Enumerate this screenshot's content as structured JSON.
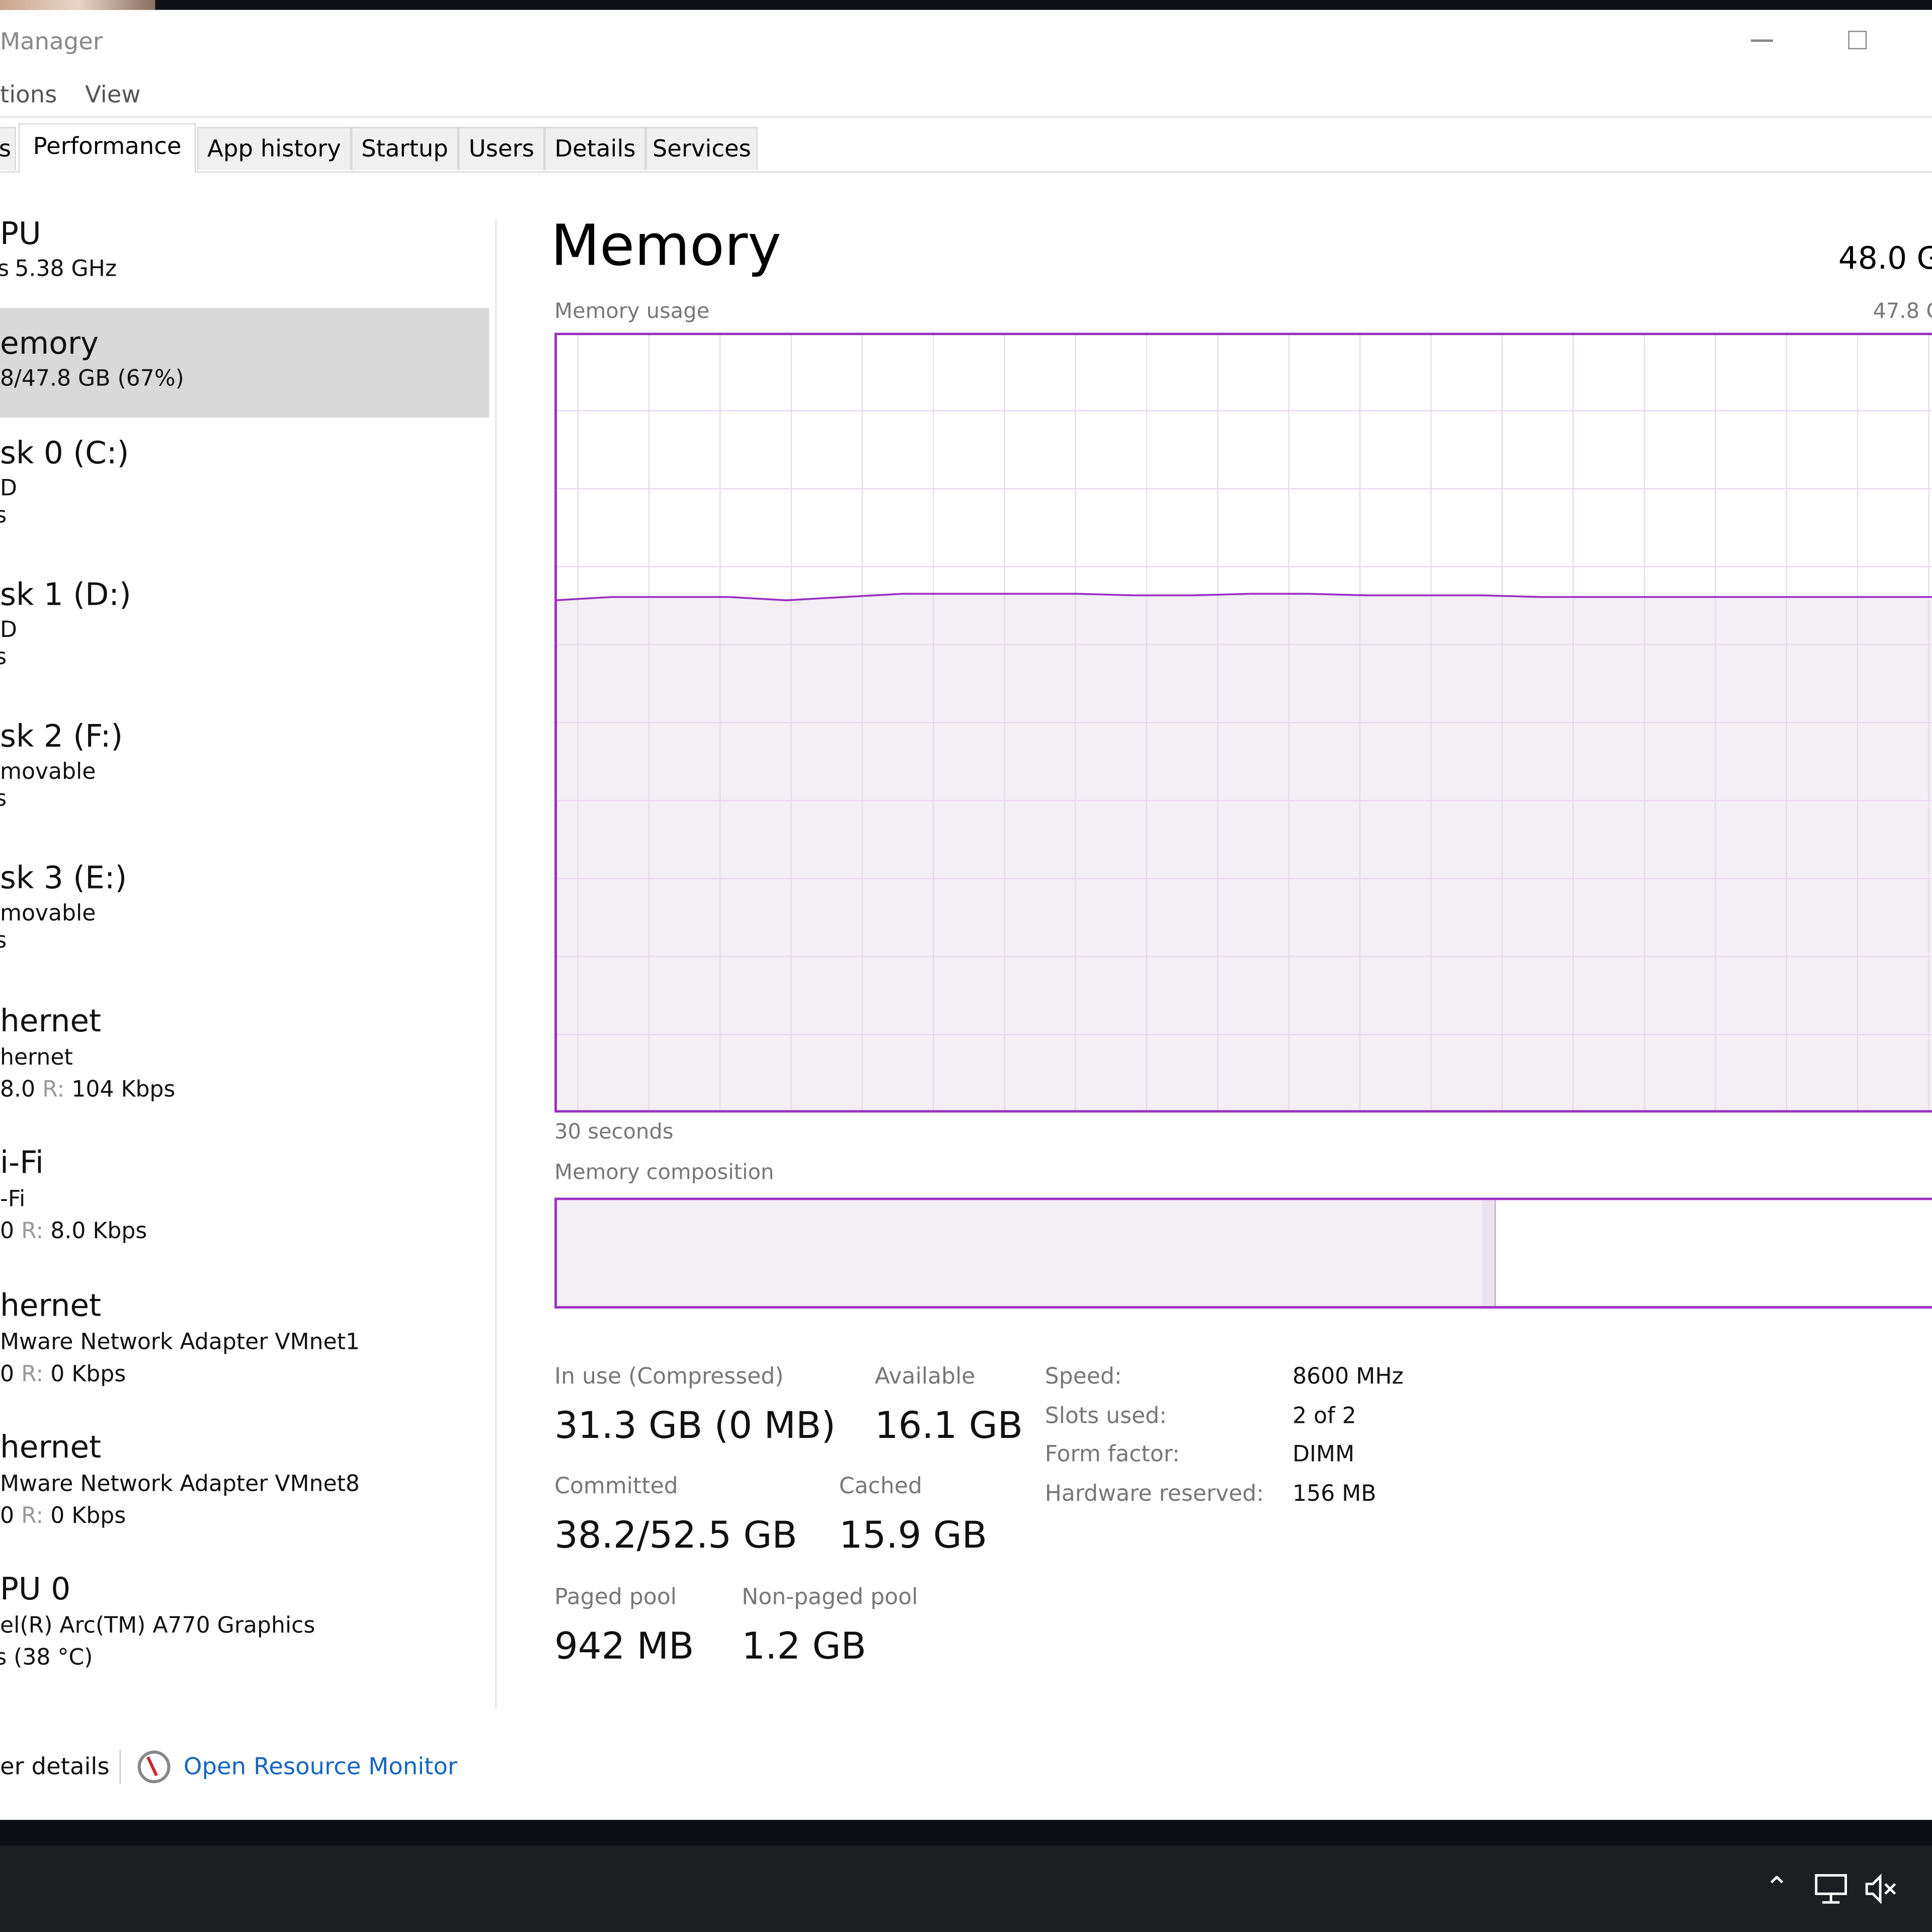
{
  "window": {
    "title": "Manager",
    "menu": [
      "tions",
      "View"
    ],
    "tabs": [
      {
        "label": "s",
        "selected": false
      },
      {
        "label": "Performance",
        "selected": true
      },
      {
        "label": "App history",
        "selected": false
      },
      {
        "label": "Startup",
        "selected": false
      },
      {
        "label": "Users",
        "selected": false
      },
      {
        "label": "Details",
        "selected": false
      },
      {
        "label": "Services",
        "selected": false
      }
    ]
  },
  "sidebar": {
    "items": [
      {
        "title": "PU",
        "lines": [
          "5.38 GHz"
        ],
        "prefix": "s"
      },
      {
        "title": "emory",
        "lines": [
          "8/47.8 GB (67%)"
        ],
        "selected": true
      },
      {
        "title": "sk 0 (C:)",
        "lines": [
          "D",
          "s"
        ]
      },
      {
        "title": "sk 1 (D:)",
        "lines": [
          "D",
          "s"
        ]
      },
      {
        "title": "sk 2 (F:)",
        "lines": [
          "movable",
          "s"
        ]
      },
      {
        "title": "sk 3 (E:)",
        "lines": [
          "movable",
          "s"
        ]
      },
      {
        "title": "hernet",
        "sub": "hernet",
        "s_val": "8.0",
        "r_label": "R:",
        "r_val": "104 Kbps"
      },
      {
        "title": "i-Fi",
        "sub": "-Fi",
        "s_val": "0",
        "r_label": "R:",
        "r_val": "8.0 Kbps"
      },
      {
        "title": "hernet",
        "sub": "Mware Network Adapter VMnet1",
        "s_val": "0",
        "r_label": "R:",
        "r_val": "0 Kbps"
      },
      {
        "title": "hernet",
        "sub": "Mware Network Adapter VMnet8",
        "s_val": "0",
        "r_label": "R:",
        "r_val": "0 Kbps"
      },
      {
        "title": "PU 0",
        "lines": [
          "el(R) Arc(TM) A770 Graphics",
          "s  (38 °C)"
        ]
      }
    ]
  },
  "main": {
    "heading": "Memory",
    "total": "48.0 G",
    "usage_label": "Memory usage",
    "usage_max": "47.8 G",
    "time_label": "30 seconds",
    "composition_label": "Memory composition",
    "stats": {
      "in_use_label": "In use (Compressed)",
      "in_use": "31.3 GB (0 MB)",
      "available_label": "Available",
      "available": "16.1 GB",
      "committed_label": "Committed",
      "committed": "38.2/52.5 GB",
      "cached_label": "Cached",
      "cached": "15.9 GB",
      "paged_label": "Paged pool",
      "paged": "942 MB",
      "nonpaged_label": "Non-paged pool",
      "nonpaged": "1.2 GB"
    },
    "specs": [
      {
        "label": "Speed:",
        "value": "8600 MHz"
      },
      {
        "label": "Slots used:",
        "value": "2 of 2"
      },
      {
        "label": "Form factor:",
        "value": "DIMM"
      },
      {
        "label": "Hardware reserved:",
        "value": "156 MB"
      }
    ]
  },
  "chart_data": {
    "type": "area",
    "ylabel": "Memory usage",
    "ylim": [
      0,
      47.8
    ],
    "y_unit": "GB",
    "x_label": "30 seconds",
    "grid": true,
    "color": "#9b2fc0",
    "values": [
      31.4,
      31.6,
      31.6,
      31.6,
      31.4,
      31.6,
      31.8,
      31.8,
      31.8,
      31.8,
      31.7,
      31.7,
      31.8,
      31.8,
      31.7,
      31.7,
      31.7,
      31.6,
      31.6,
      31.6,
      31.6,
      31.6,
      31.6,
      31.6,
      31.6
    ]
  },
  "composition": {
    "in_use_fraction": 0.667,
    "modified_fraction": 0.009,
    "color": "#9b2fc0"
  },
  "footer": {
    "details": "er details",
    "resource_monitor": "Open Resource Monitor"
  },
  "tray": {
    "icons": [
      "chevron-up-icon",
      "network-icon",
      "speaker-muted-icon"
    ]
  }
}
